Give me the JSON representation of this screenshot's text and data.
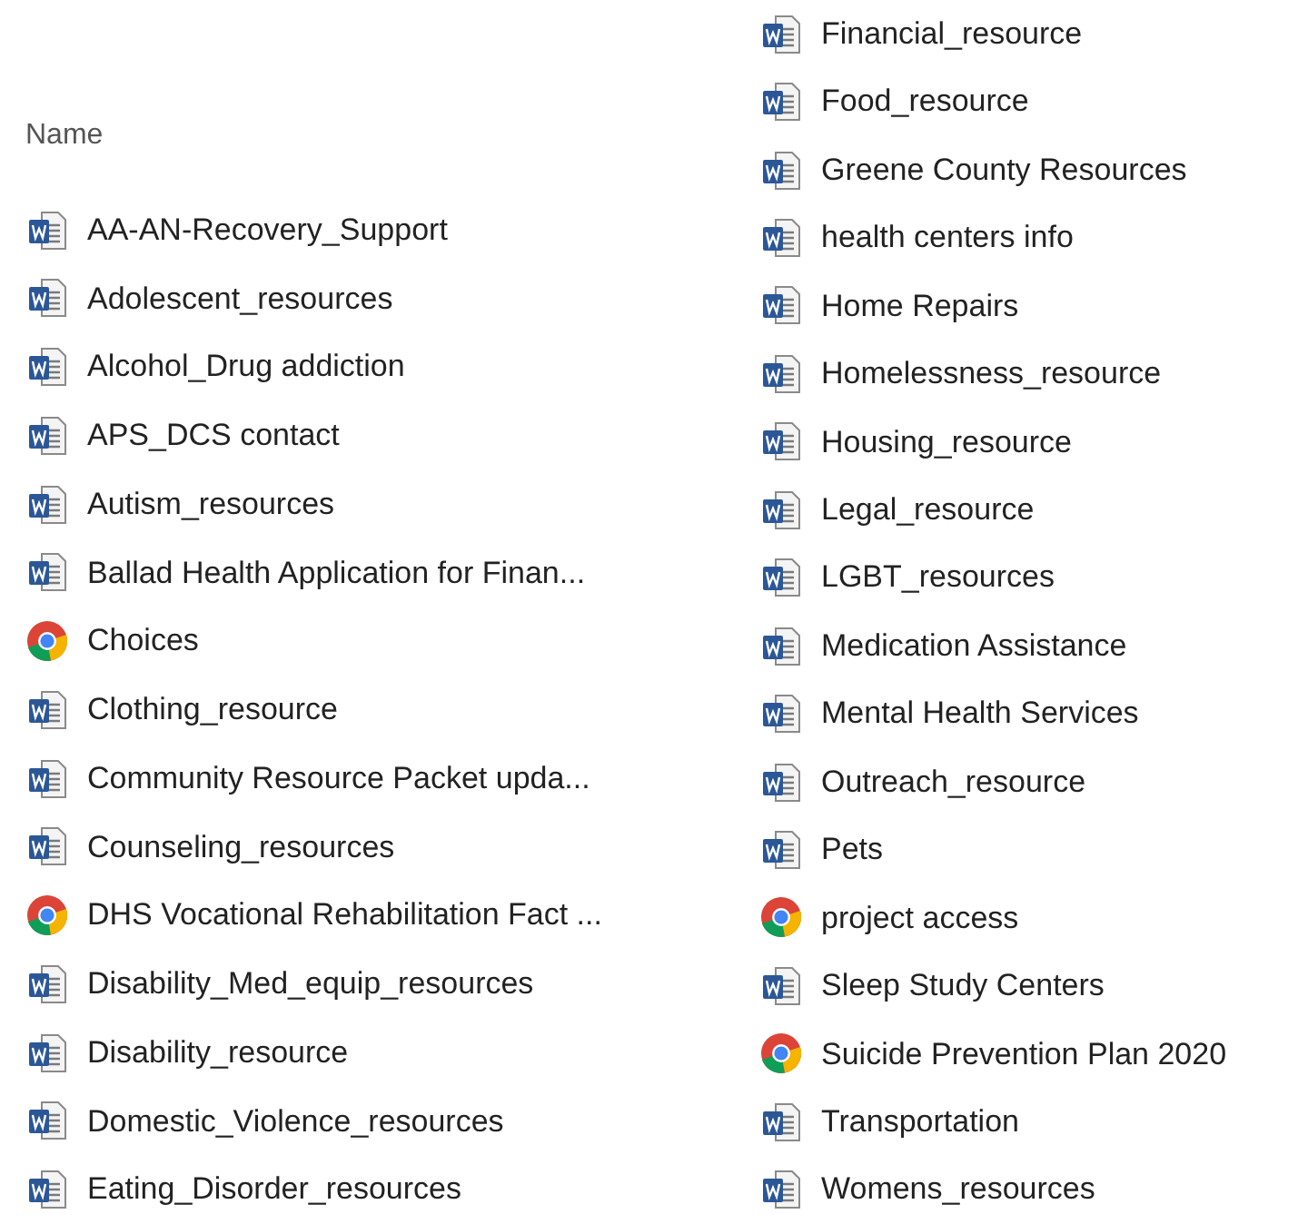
{
  "header": {
    "label": "Name"
  },
  "columns": [
    [
      {
        "name": "AA-AN-Recovery_Support",
        "kind": "word"
      },
      {
        "name": "Adolescent_resources",
        "kind": "word"
      },
      {
        "name": "Alcohol_Drug addiction",
        "kind": "word"
      },
      {
        "name": "APS_DCS contact",
        "kind": "word"
      },
      {
        "name": "Autism_resources",
        "kind": "word"
      },
      {
        "name": "Ballad Health Application for Finan...",
        "kind": "word"
      },
      {
        "name": "Choices",
        "kind": "chrome"
      },
      {
        "name": "Clothing_resource",
        "kind": "word"
      },
      {
        "name": "Community Resource Packet upda...",
        "kind": "word"
      },
      {
        "name": "Counseling_resources",
        "kind": "word"
      },
      {
        "name": "DHS Vocational Rehabilitation Fact ...",
        "kind": "chrome"
      },
      {
        "name": "Disability_Med_equip_resources",
        "kind": "word"
      },
      {
        "name": "Disability_resource",
        "kind": "word"
      },
      {
        "name": "Domestic_Violence_resources",
        "kind": "word"
      },
      {
        "name": "Eating_Disorder_resources",
        "kind": "word"
      }
    ],
    [
      {
        "name": "Financial_resource",
        "kind": "word"
      },
      {
        "name": "Food_resource",
        "kind": "word"
      },
      {
        "name": "Greene County Resources",
        "kind": "word"
      },
      {
        "name": "health centers info",
        "kind": "word"
      },
      {
        "name": "Home Repairs",
        "kind": "word"
      },
      {
        "name": "Homelessness_resource",
        "kind": "word"
      },
      {
        "name": "Housing_resource",
        "kind": "word"
      },
      {
        "name": "Legal_resource",
        "kind": "word"
      },
      {
        "name": "LGBT_resources",
        "kind": "word"
      },
      {
        "name": "Medication Assistance",
        "kind": "word"
      },
      {
        "name": "Mental Health Services",
        "kind": "word"
      },
      {
        "name": "Outreach_resource",
        "kind": "word"
      },
      {
        "name": "Pets",
        "kind": "word"
      },
      {
        "name": "project access",
        "kind": "chrome"
      },
      {
        "name": "Sleep Study Centers",
        "kind": "word"
      },
      {
        "name": "Suicide Prevention Plan 2020",
        "kind": "chrome"
      },
      {
        "name": "Transportation",
        "kind": "word"
      },
      {
        "name": "Womens_resources",
        "kind": "word"
      }
    ]
  ]
}
